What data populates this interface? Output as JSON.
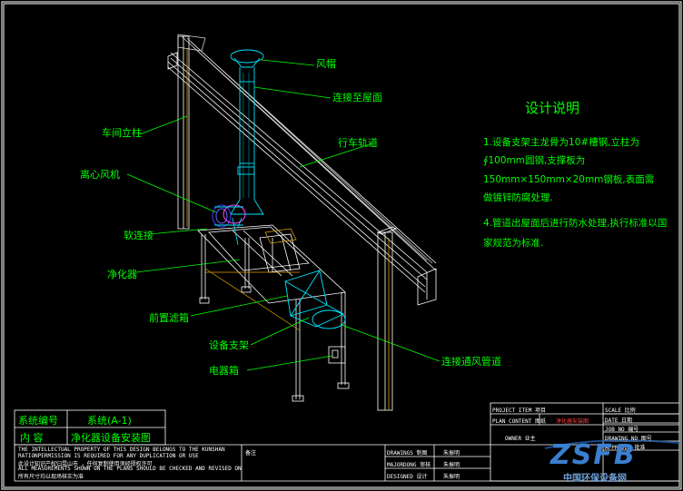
{
  "labels": {
    "hood": "风帽",
    "roof": "连接至屋面",
    "column": "车间立柱",
    "rail": "行车轨道",
    "fan": "离心风机",
    "soft": "软连接",
    "purifier": "净化器",
    "prefilter": "前置滤箱",
    "support": "设备支架",
    "elec": "电器箱",
    "duct": "连接通风管道"
  },
  "notes": {
    "title": "设计说明",
    "n1a": "1.设备支架主龙骨为10#槽钢,立柱为",
    "n1b": "∮100mm圆钢,支撑板为",
    "n1c": "150mm×150mm×20mm钢板,表面需",
    "n1d": "做镀锌防腐处理.",
    "n2a": "4.管道出屋面后进行防水处理,执行标准以国",
    "n2b": "家规范为标准."
  },
  "title_block": {
    "sys_label": "系统编号",
    "sys_value": "系统(A-1)",
    "content_label": "内  容",
    "content_value": "净化器设备安装图",
    "ip1": "THE INTELLECTUAL PROPERTY OF THIS DESIGN BELONGS TO THE KUNSHAN",
    "ip2": "RATIONPERMISSION IS REQUIRED FOR ANY DUPLICATION OR USE",
    "ip3": "此设计知识产权归昆山市 ，任何复制使用须经授权许可",
    "ip4": "ALL MEASUREMENTS SHOWN ON THE PLANS SHOULD BE CHECKED AND REVISED ON",
    "ip5": "所有尺寸均以现场核实为准",
    "remark": "备注",
    "drawing": "DRAWINGS 制图",
    "drawing_v": "朱振明",
    "majoring": "MAJORDONG 审核",
    "majoring_v": "朱振明",
    "designed": "DESIGNED 设计",
    "designed_v": "朱振明",
    "project": "PROJECT ITEM 项目",
    "plan": "PLAN CONTENT 图纸",
    "plan_v": "净化器安装图",
    "owner": "OWNER 业主",
    "scale": "SCALE 比例",
    "date": "DATE 日期",
    "job": "JOB NO 编号",
    "drawno": "DRAWING NO 图号",
    "approved": "APPROVED 批准"
  },
  "watermark": {
    "logo": "ZSFB",
    "site": "中国环保设备网"
  }
}
